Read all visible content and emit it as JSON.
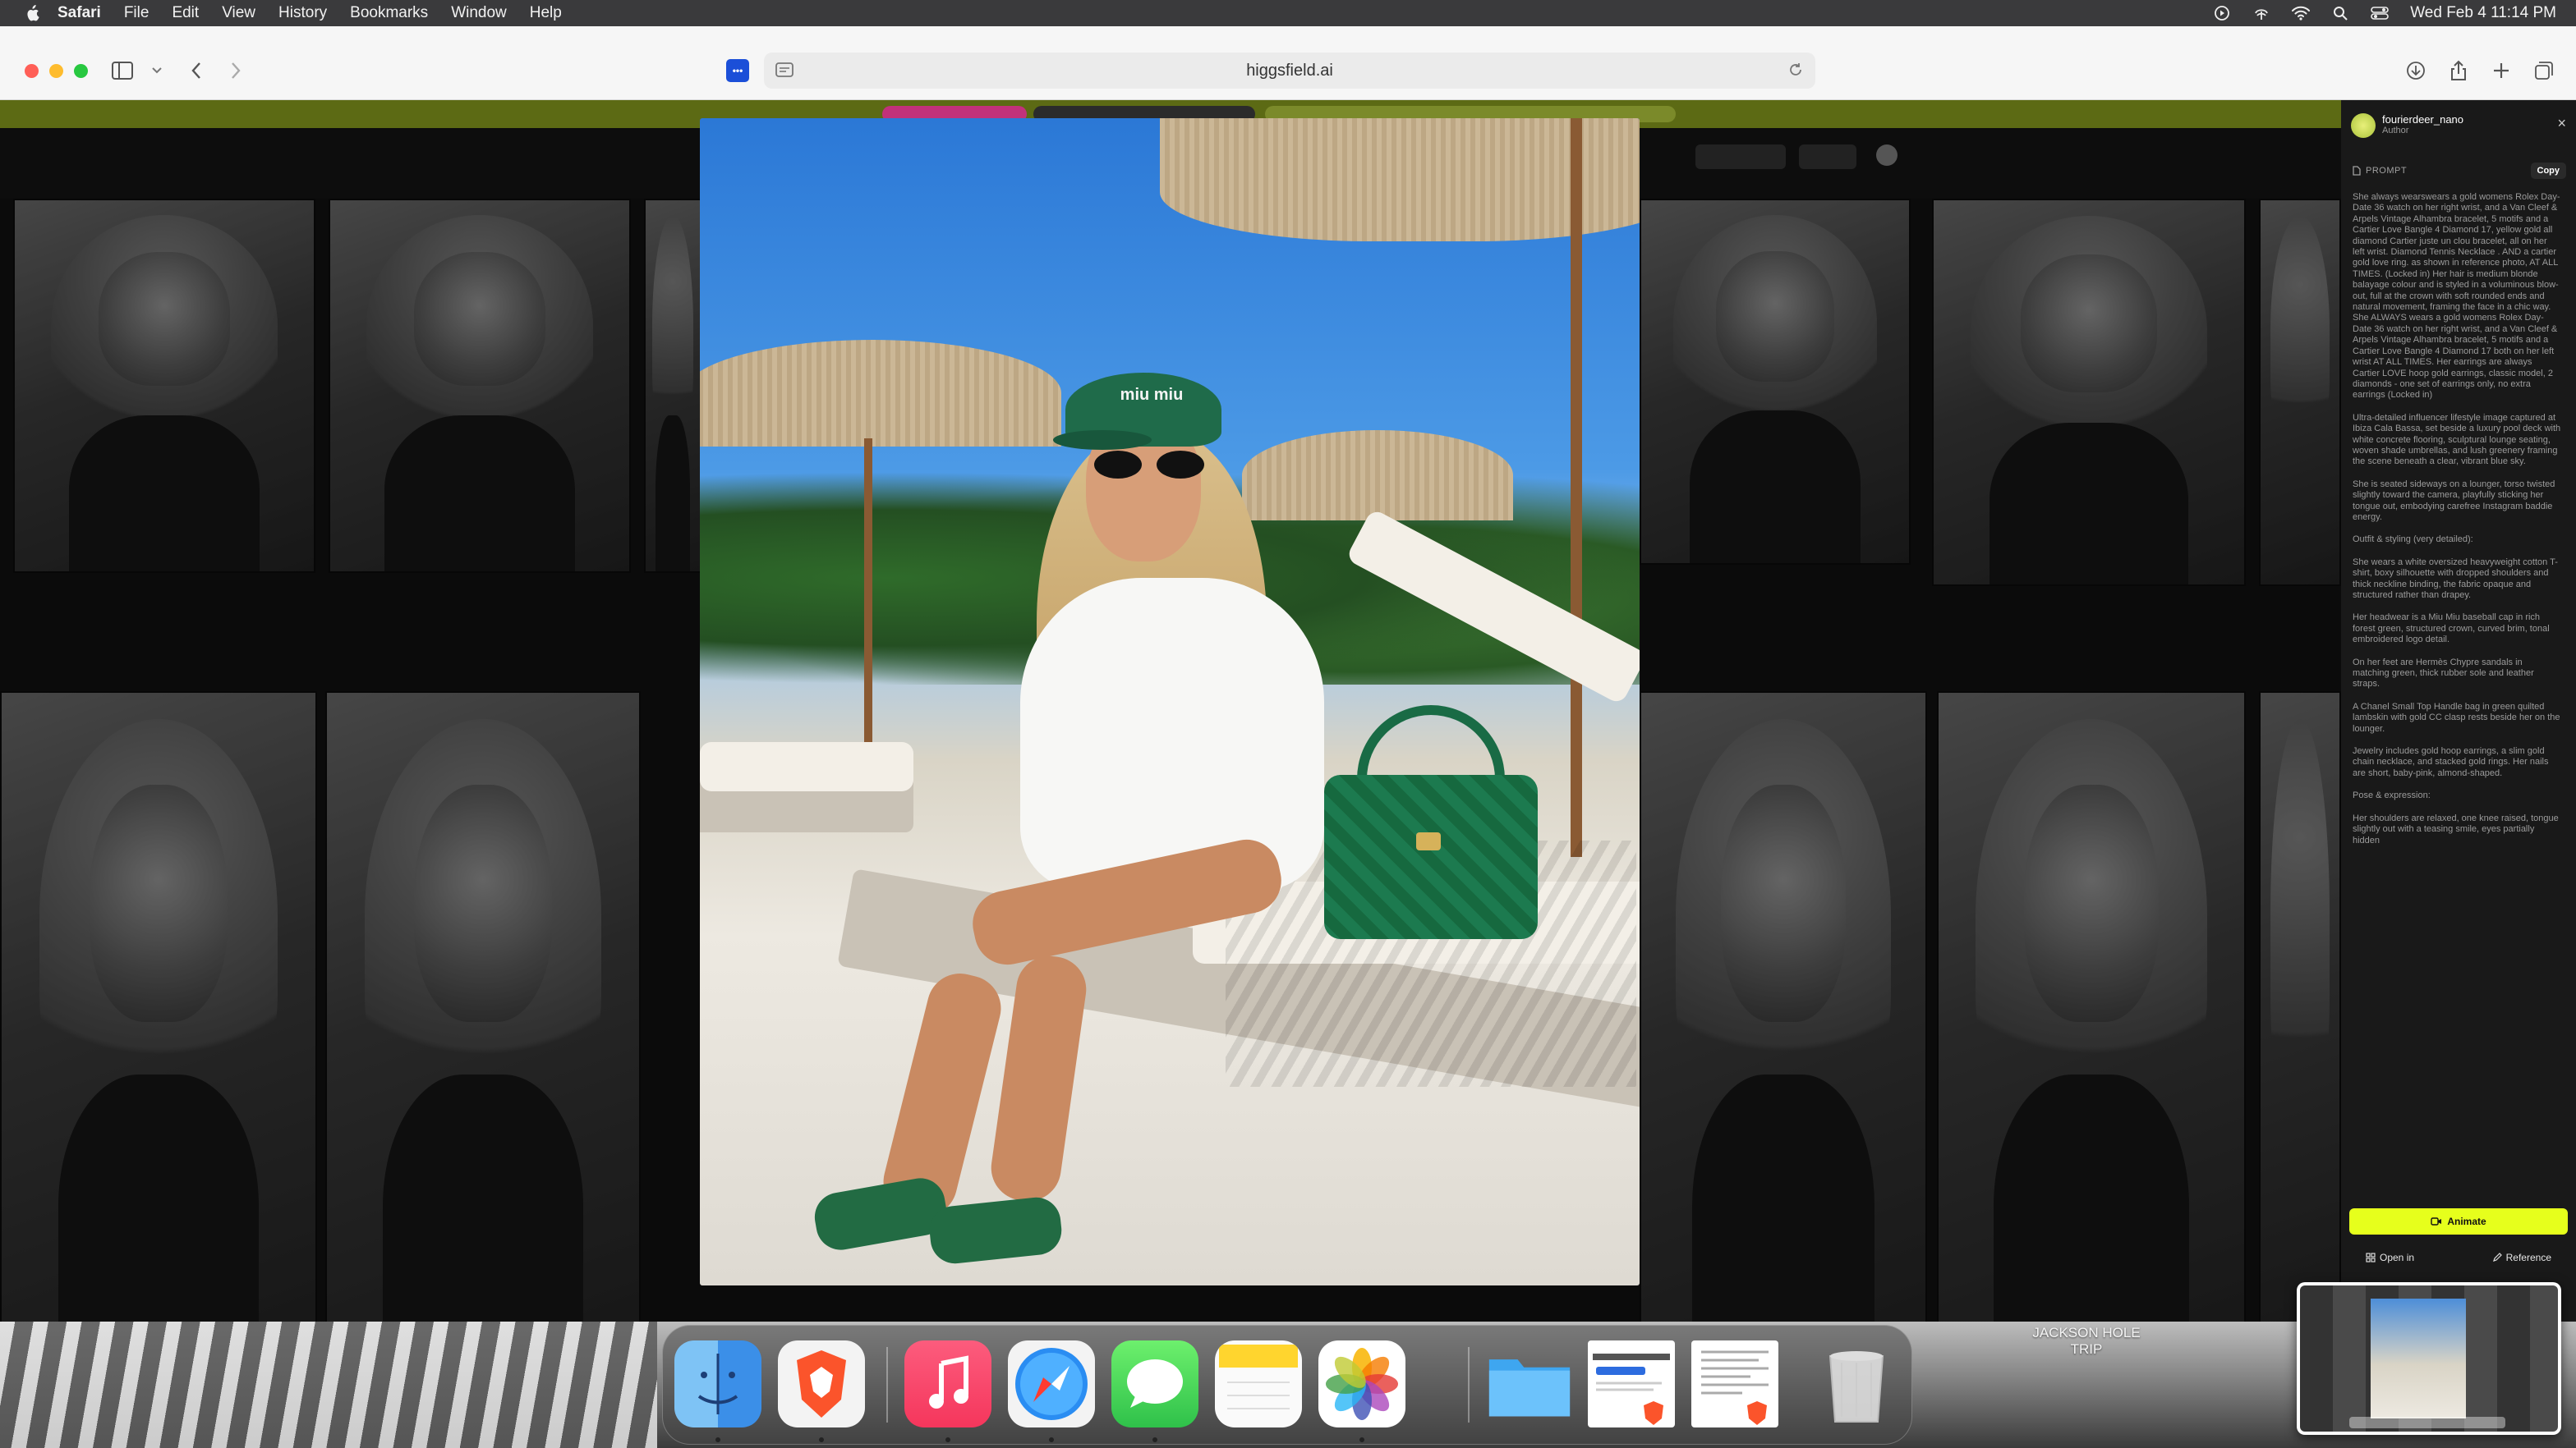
{
  "menubar": {
    "app": "Safari",
    "items": [
      "File",
      "Edit",
      "View",
      "History",
      "Bookmarks",
      "Window",
      "Help"
    ],
    "clock": "Wed Feb 4  11:14 PM"
  },
  "browser": {
    "url": "higgsfield.ai",
    "tab_favicon_text": "•••"
  },
  "panel": {
    "username": "fourierdeer_nano",
    "role": "Author",
    "close_symbol": "×",
    "prompt_label": "PROMPT",
    "copy_label": "Copy",
    "prompt_paragraphs": [
      "She always wearswears a gold womens Rolex Day-Date 36 watch on her right wrist, and a Van Cleef & Arpels Vintage Alhambra bracelet, 5 motifs and a Cartier Love Bangle 4 Diamond 17, yellow gold all diamond Cartier juste un clou bracelet, all  on her left wrist. Diamond Tennis Necklace . AND a cartier gold love ring.  as shown in reference photo, AT ALL TIMES. (Locked in) Her hair is medium blonde balayage colour and is styled in a  voluminous blow-out, full at the crown with soft rounded ends and natural movement, framing the face in a chic way. She ALWAYS wears a gold womens Rolex Day-Date 36 watch on her right wrist, and a Van Cleef & Arpels Vintage Alhambra bracelet, 5 motifs and a Cartier Love Bangle 4 Diamond 17 both on her left wrist AT ALL TIMES. Her earrings are always Cartier LOVE hoop gold earrings, classic model, 2 diamonds - one set of earrings only, no extra earrings (Locked in)",
      "Ultra-detailed influencer lifestyle image captured at Ibiza Cala Bassa, set beside a luxury pool deck with white concrete flooring, sculptural lounge seating, woven shade umbrellas, and lush greenery framing the scene beneath a clear, vibrant blue sky.",
      "She is seated sideways on a lounger, torso twisted slightly toward the camera, playfully sticking her tongue out, embodying carefree Instagram baddie energy.",
      "Outfit & styling (very detailed):",
      "She wears a white oversized heavyweight cotton T-shirt, boxy silhouette with dropped shoulders and thick neckline binding, the fabric opaque and structured rather than drapey.",
      "Her headwear is a Miu Miu baseball cap in rich forest green, structured crown, curved brim, tonal embroidered logo detail.",
      "On her feet are Hermès Chypre sandals in matching green, thick rubber sole and leather straps.",
      "A Chanel Small Top Handle bag in green quilted lambskin with gold CC clasp rests beside her on the lounger.",
      "Jewelry includes gold hoop earrings, a slim gold chain necklace, and stacked gold rings. Her nails are short, baby-pink, almond-shaped.",
      "Pose & expression:",
      "Her shoulders are relaxed, one knee raised, tongue slightly out with a teasing smile, eyes partially hidden"
    ],
    "animate_label": "Animate",
    "open_in_label": "Open in",
    "reference_label": "Reference"
  },
  "photo": {
    "cap_text": "miu miu"
  },
  "desktop": {
    "folder_label": "JACKSON HOLE\nTRIP"
  },
  "dock": {
    "apps": [
      "Finder",
      "Brave Browser",
      "Music",
      "Safari",
      "Messages",
      "Notes",
      "Photos",
      "Downloads",
      "Document",
      "Document",
      "Trash"
    ]
  }
}
